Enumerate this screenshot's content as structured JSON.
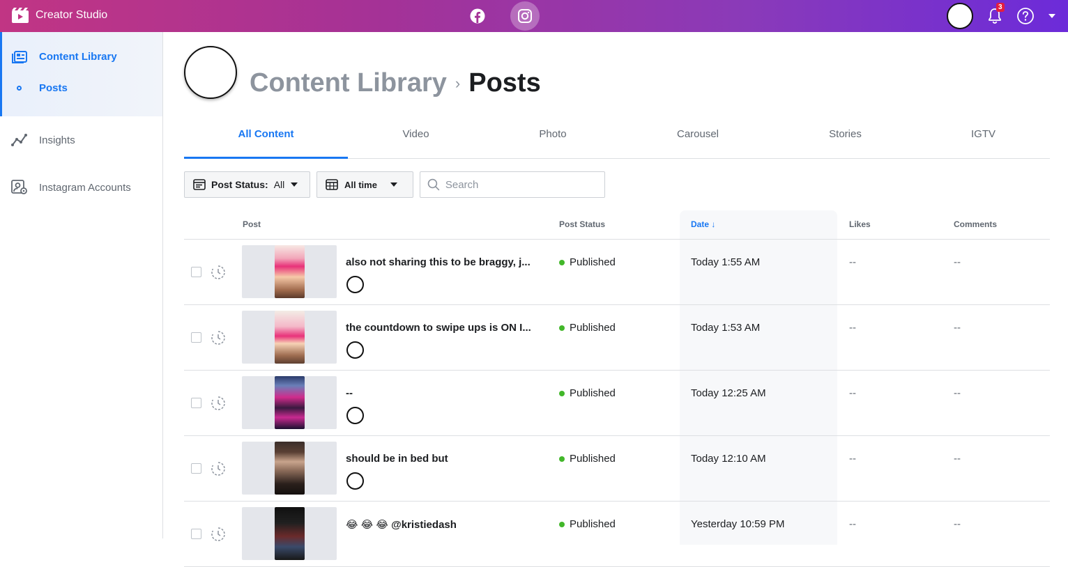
{
  "app": {
    "title": "Creator Studio"
  },
  "topbar": {
    "notifications_count": "3"
  },
  "sidebar": {
    "items": [
      {
        "label": "Content Library"
      },
      {
        "label": "Posts"
      },
      {
        "label": "Insights"
      },
      {
        "label": "Instagram Accounts"
      }
    ]
  },
  "breadcrumb": {
    "parent": "Content Library",
    "separator": "›",
    "current": "Posts"
  },
  "tabs": [
    {
      "label": "All Content"
    },
    {
      "label": "Video"
    },
    {
      "label": "Photo"
    },
    {
      "label": "Carousel"
    },
    {
      "label": "Stories"
    },
    {
      "label": "IGTV"
    }
  ],
  "filters": {
    "post_status_key": "Post Status:",
    "post_status_value": "All",
    "time_value": "All time",
    "search_placeholder": "Search"
  },
  "table": {
    "columns": {
      "post": "Post",
      "status": "Post Status",
      "date": "Date ↓",
      "likes": "Likes",
      "comments": "Comments"
    },
    "rows": [
      {
        "caption": "also not sharing this to be braggy, j...",
        "status": "Published",
        "date": "Today 1:55 AM",
        "likes": "--",
        "comments": "--"
      },
      {
        "caption": "the countdown to swipe ups is ON I...",
        "status": "Published",
        "date": "Today 1:53 AM",
        "likes": "--",
        "comments": "--"
      },
      {
        "caption": "--",
        "status": "Published",
        "date": "Today 12:25 AM",
        "likes": "--",
        "comments": "--"
      },
      {
        "caption": "should be in bed but",
        "status": "Published",
        "date": "Today 12:10 AM",
        "likes": "--",
        "comments": "--"
      },
      {
        "caption": "😂 😂 😂  @kristiedash",
        "status": "Published",
        "date": "Yesterday 10:59 PM",
        "likes": "--",
        "comments": "--"
      }
    ]
  },
  "colors": {
    "accent": "#1877f2",
    "published": "#42b72a"
  }
}
